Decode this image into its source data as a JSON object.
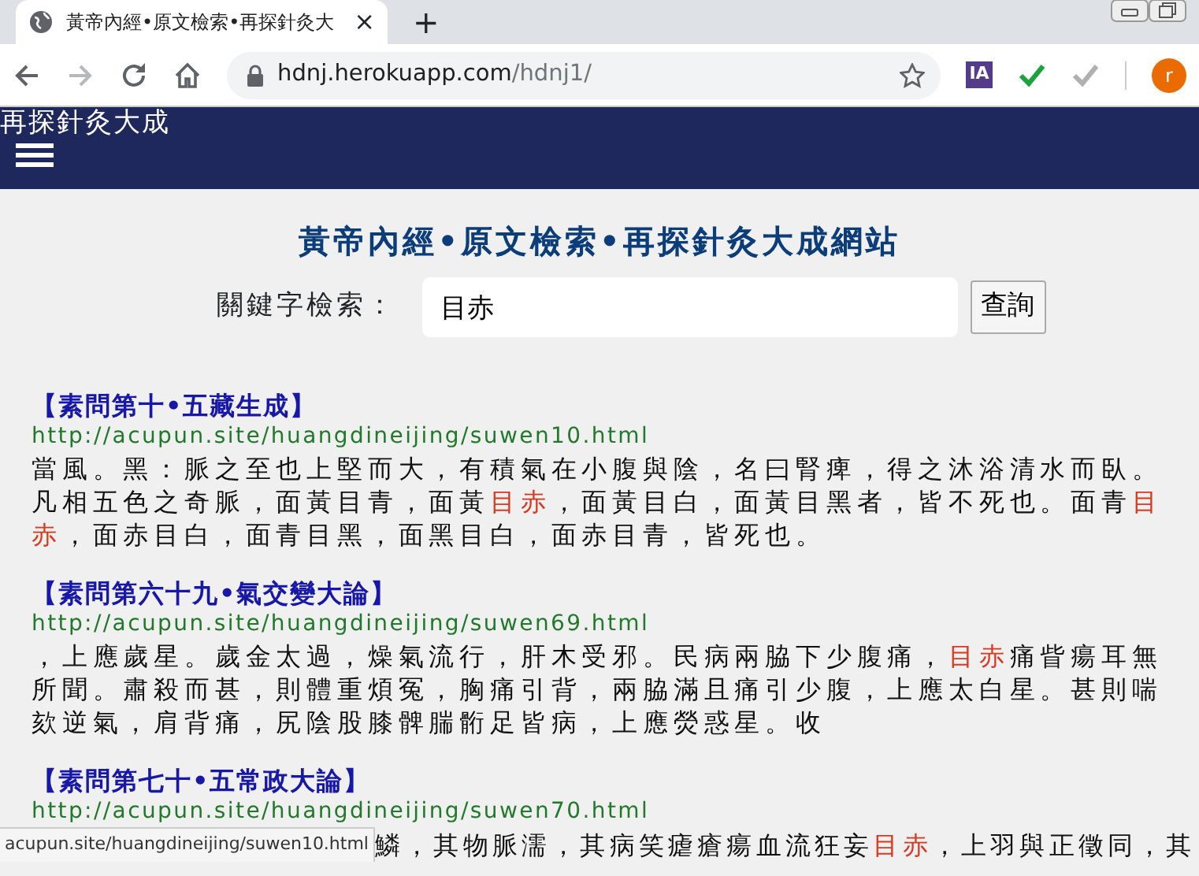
{
  "browser": {
    "tab": {
      "title": "黃帝內經•原文檢索•再探針灸大",
      "close": "×",
      "selected": true
    },
    "new_tab": "+",
    "address": {
      "host": "hdnj.herokuapp.com",
      "path": "/hdnj1/"
    },
    "extensions": [
      {
        "kind": "ia",
        "label": "IA"
      },
      {
        "kind": "check",
        "color": "#1aa33a"
      },
      {
        "kind": "check",
        "color": "#b0b0b0"
      }
    ],
    "avatar": "r"
  },
  "navbar": {
    "brand": "再探針灸大成"
  },
  "page": {
    "title": "黃帝內經•原文檢索•再探針灸大成網站",
    "search": {
      "label": "關鍵字檢索：",
      "value": "目赤",
      "button": "查詢"
    }
  },
  "results": [
    {
      "heading": "【素問第十•五藏生成】",
      "url": "http://acupun.site/huangdineijing/suwen10.html",
      "snippet": [
        {
          "text": "當風。黑：脈之至也上堅而大，有積氣在小腹與陰，名曰腎痺，得之沐浴清水而臥。凡相五色之奇脈，面黃目青，面黃",
          "highlight": false
        },
        {
          "text": "目赤",
          "highlight": true
        },
        {
          "text": "，面黃目白，面黃目黑者，皆不死也。面青",
          "highlight": false
        },
        {
          "text": "目赤",
          "highlight": true
        },
        {
          "text": "，面赤目白，面青目黑，面黑目白，面赤目青，皆死也。",
          "highlight": false
        }
      ]
    },
    {
      "heading": "【素問第六十九•氣交變大論】",
      "url": "http://acupun.site/huangdineijing/suwen69.html",
      "snippet": [
        {
          "text": "，上應歲星。歲金太過，燥氣流行，肝木受邪。民病兩脇下少腹痛，",
          "highlight": false
        },
        {
          "text": "目赤",
          "highlight": true
        },
        {
          "text": "痛眥瘍耳無所聞。肅殺而甚，則體重煩冤，胸痛引背，兩脇滿且痛引少腹，上應太白星。甚則喘欬逆氣，肩背痛，尻陰股膝髀腨䯒足皆病，上應熒惑星。收",
          "highlight": false
        }
      ]
    },
    {
      "heading": "【素問第七十•五常政大論】",
      "url": "http://acupun.site/huangdineijing/suwen70.html",
      "snippet": [
        {
          "text": "鱗，其物脈濡，其病笑瘧瘡瘍血流狂妄",
          "highlight": false
        },
        {
          "text": "目赤",
          "highlight": true
        },
        {
          "text": "，上羽與正徵同，其",
          "highlight": false
        }
      ]
    }
  ],
  "status_bar": "acupun.site/huangdineijing/suwen10.html"
}
